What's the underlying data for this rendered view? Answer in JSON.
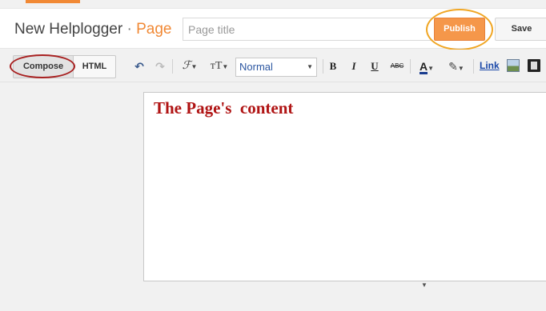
{
  "header": {
    "blog_name": "New Helplogger",
    "separator": "·",
    "page_word": "Page",
    "title_placeholder": "Page title",
    "publish_label": "Publish",
    "save_label": "Save"
  },
  "toolbar": {
    "compose_label": "Compose",
    "html_label": "HTML",
    "undo_icon": "↶",
    "redo_icon": "↷",
    "font_icon": "ℱ",
    "size_icon": "тT",
    "format_value": "Normal",
    "bold": "B",
    "italic": "I",
    "underline": "U",
    "strike": "ABC",
    "text_color": "A",
    "highlight_icon": "✎",
    "dropdown_arrow": "▼",
    "link_label": "Link"
  },
  "editor": {
    "content": "The Page's  content"
  },
  "colors": {
    "accent": "#f18935",
    "publish": "#f5974a",
    "content_text": "#b01414",
    "link": "#1a48a8"
  }
}
